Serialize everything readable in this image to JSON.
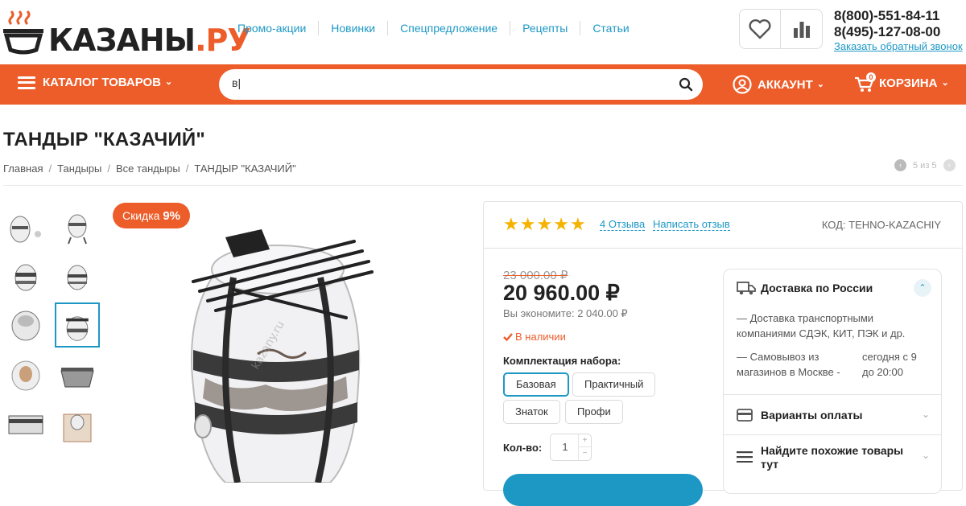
{
  "header": {
    "logo": "КАЗАНЫ.РУ",
    "logo_main": "КАЗАНЫ",
    "logo_ru": ".РУ",
    "nav": [
      "Промо-акции",
      "Новинки",
      "Спецпредложение",
      "Рецепты",
      "Статьи"
    ],
    "phones": [
      "8(800)-551-84-11",
      "8(495)-127-08-00"
    ],
    "callback": "Заказать обратный звонок",
    "icons": [
      "heart-icon",
      "compare-icon"
    ]
  },
  "menubar": {
    "catalog": "КАТАЛОГ ТОВАРОВ",
    "search_value": "в|",
    "account": "АККАУНТ",
    "cart": "КОРЗИНА",
    "cart_count": "0"
  },
  "product": {
    "title": "ТАНДЫР \"КАЗАЧИЙ\"",
    "breadcrumbs": [
      "Главная",
      "Тандыры",
      "Все тандыры",
      "ТАНДЫР \"КАЗАЧИЙ\""
    ],
    "pager": "5 из 5",
    "discount_label": "Скидка",
    "discount_value": "9%",
    "thumbnail_count": 10,
    "selected_thumbnail": 6,
    "rating": 5,
    "reviews": "4 Отзыва",
    "write_review": "Написать отзыв",
    "sku": "КОД: TEHNO-KAZACHIY",
    "old_price": "23 000.00 ₽",
    "price": "20 960.00 ₽",
    "savings": "Вы экономите: 2 040.00 ₽",
    "stock": "В наличии",
    "kit_label": "Комплектация набора:",
    "kit_options": [
      "Базовая",
      "Практичный",
      "Знаток",
      "Профи"
    ],
    "kit_selected": "Базовая",
    "qty_label": "Кол-во:",
    "qty_value": "1",
    "plus": "+",
    "minus": "−"
  },
  "delivery": {
    "title": "Доставка по России",
    "line1": "— Доставка транспортными компаниями СДЭК, КИТ, ПЭК и др.",
    "pickup_left": "— Самовывоз из магазинов в Москве -",
    "pickup_right": "сегодня с 9 до 20:00",
    "payment": "Варианты оплаты",
    "similar": "Найдите похожие товары тут"
  },
  "colors": {
    "accent": "#ec5d2a",
    "link": "#1d98c5",
    "star": "#f5b301"
  }
}
